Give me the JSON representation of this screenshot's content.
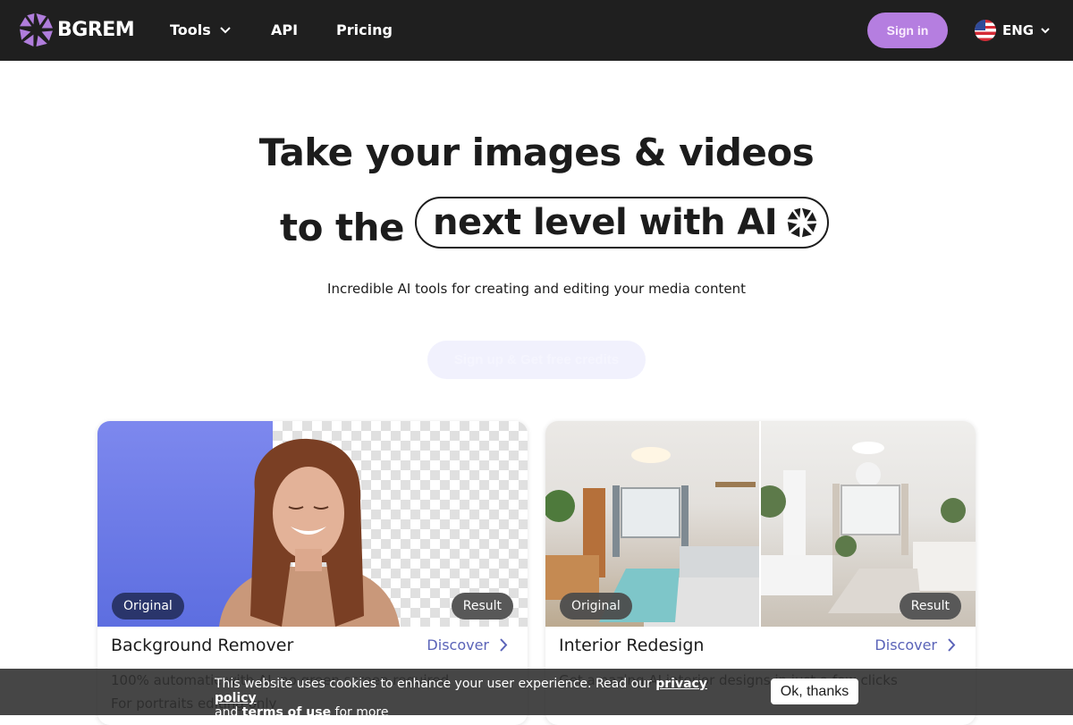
{
  "header": {
    "logo_text": "BGREM",
    "nav": [
      {
        "label": "Tools",
        "has_dropdown": true
      },
      {
        "label": "API"
      },
      {
        "label": "Pricing"
      }
    ],
    "signin_label": "Sign in",
    "language": {
      "label": "ENG",
      "flag": "us-flag-icon"
    },
    "brand_color": "#b57ee0"
  },
  "hero": {
    "line1": "Take your images & videos",
    "line2_prefix": "to the",
    "line2_highlight": "next level with AI",
    "subtitle": "Incredible AI tools for creating and editing your media content",
    "cta_label": "Sign up & Get free credits"
  },
  "cards": [
    {
      "title": "Background Remover",
      "link_label": "Discover",
      "badge_left": "Original",
      "badge_right": "Result",
      "desc_lines": [
        "100% automatic with AI, no green screen required",
        "For portraits editing only"
      ]
    },
    {
      "title": "Interior Redesign",
      "link_label": "Discover",
      "badge_left": "Original",
      "badge_right": "Result",
      "desc_lines": [
        "Get amazing AI interior designs in just a few clicks"
      ]
    }
  ],
  "cookie_banner": {
    "text_before": "This website uses cookies to enhance your user experience. Read our ",
    "privacy_link": "privacy policy",
    "text_middle": " and ",
    "terms_link": "terms of use",
    "text_after": " for more",
    "ok_label": "Ok, thanks"
  }
}
